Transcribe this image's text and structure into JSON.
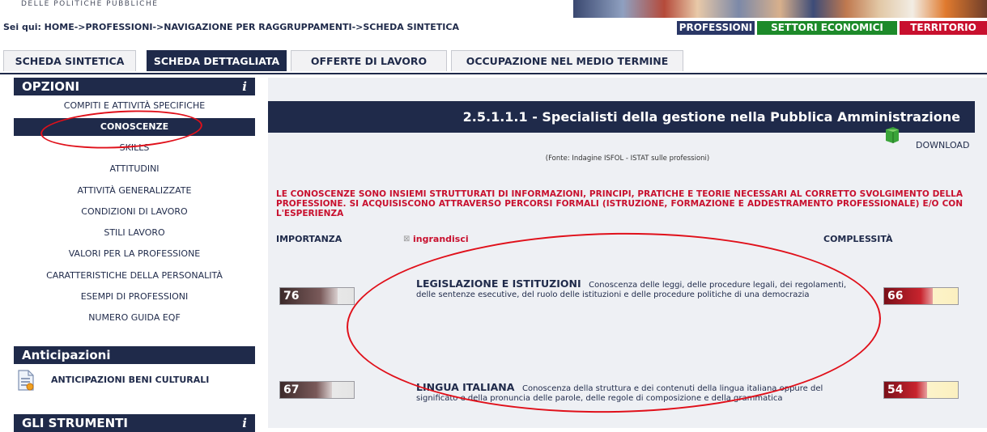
{
  "banner": {
    "logo_text": "DELLE POLITICHE PUBBLICHE"
  },
  "breadcrumb": "Sei qui: HOME->PROFESSIONI->NAVIGAZIONE PER RAGGRUPPAMENTI->SCHEDA SINTETICA",
  "topnav": {
    "professioni": "PROFESSIONI",
    "settori": "SETTORI ECONOMICI",
    "territorio": "TERRITORIO"
  },
  "tabs": [
    {
      "label": "SCHEDA SINTETICA"
    },
    {
      "label": "SCHEDA DETTAGLIATA"
    },
    {
      "label": "OFFERTE DI LAVORO"
    },
    {
      "label": "OCCUPAZIONE NEL MEDIO TERMINE"
    }
  ],
  "sidebar": {
    "opzioni_title": "OPZIONI",
    "info_icon": "i",
    "items": [
      "COMPITI E ATTIVITÀ SPECIFICHE",
      "CONOSCENZE",
      "SKILLS",
      "ATTITUDINI",
      "ATTIVITÀ GENERALIZZATE",
      "CONDIZIONI DI LAVORO",
      "STILI LAVORO",
      "VALORI PER LA PROFESSIONE",
      "CARATTERISTICHE DELLA PERSONALITÀ",
      "ESEMPI DI PROFESSIONI",
      "NUMERO GUIDA EQF"
    ],
    "anticipazioni_title": "Anticipazioni",
    "anticipazioni_item": "ANTICIPAZIONI BENI CULTURALI",
    "strumenti_title": "GLI STRUMENTI"
  },
  "main": {
    "title": "2.5.1.1.1 - Specialisti della gestione nella Pubblica Amministrazione",
    "download": "DOWNLOAD",
    "fonte": "(Fonte: Indagine ISFOL - ISTAT sulle professioni)",
    "intro": "LE CONOSCENZE SONO INSIEMI STRUTTURATI DI INFORMAZIONI, PRINCIPI, PRATICHE E TEORIE NECESSARI AL CORRETTO SVOLGIMENTO DELLA PROFESSIONE. SI ACQUISISCONO ATTRAVERSO PERCORSI FORMALI (ISTRUZIONE, FORMAZIONE E ADDESTRAMENTO PROFESSIONALE) E/O CON L'ESPERIENZA",
    "importanza_label": "IMPORTANZA",
    "ingrandisci": "ingrandisci",
    "complessita_label": "COMPLESSITÀ",
    "knowledge": [
      {
        "name": "LEGISLAZIONE E ISTITUZIONI",
        "description": "Conoscenza delle leggi, delle procedure legali, dei regolamenti, delle sentenze esecutive, del ruolo delle istituzioni e delle procedure politiche di una democrazia",
        "importanza": "76",
        "complessita": "66"
      },
      {
        "name": "LINGUA ITALIANA",
        "description": "Conoscenza della struttura e dei contenuti della lingua italiana oppure del significato e della pronuncia delle parole, delle regole di composizione e della grammatica",
        "importanza": "67",
        "complessita": "54"
      }
    ]
  },
  "colors": {
    "navy": "#1f2a4a",
    "red": "#c8102e",
    "green": "#1d8a2a"
  }
}
